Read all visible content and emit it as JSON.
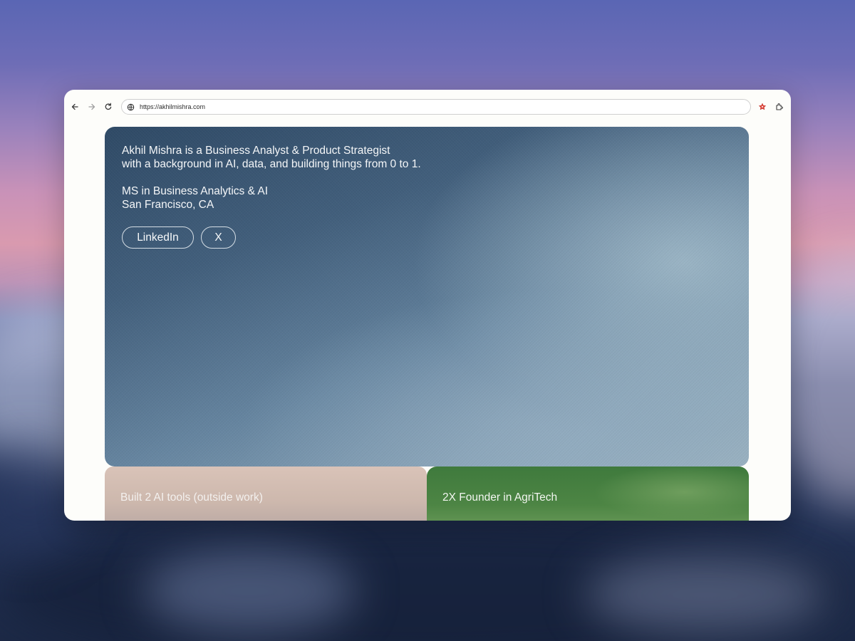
{
  "browser": {
    "url": "https://akhilmishra.com",
    "icons": [
      "arrow-left-icon",
      "arrow-right-icon",
      "reload-icon",
      "site-info-icon",
      "bookmark-star-icon",
      "extensions-icon"
    ]
  },
  "hero": {
    "bio_line_1": "Akhil Mishra is a Business Analyst & Product Strategist",
    "bio_line_2": "with a background in AI, data, and building things from 0 to 1.",
    "degree": "MS in Business Analytics & AI",
    "location": "San Francisco, CA",
    "links": [
      {
        "label": "LinkedIn"
      },
      {
        "label": "X"
      }
    ]
  },
  "cards": [
    {
      "label": "Built 2 AI tools (outside work)"
    },
    {
      "label": "2X Founder in AgriTech"
    }
  ],
  "colors": {
    "hero_top": "#2f4a66",
    "hero_bottom": "#9bb2c0",
    "card_ai": "#d9c3b8",
    "card_agri": "#3f7a3d",
    "bookmark_star": "#e0483e"
  }
}
